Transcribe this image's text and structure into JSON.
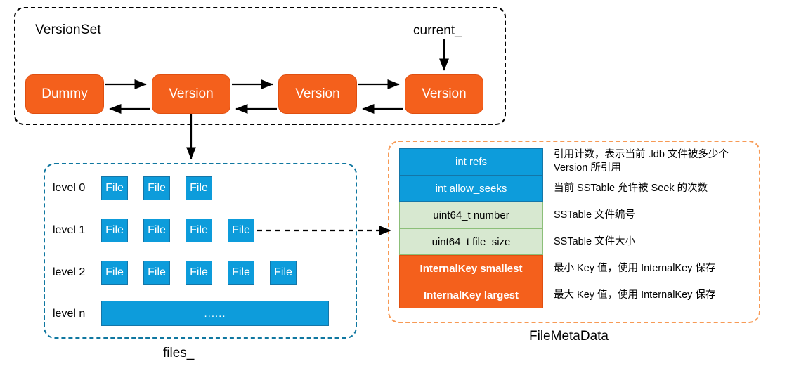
{
  "diagram": {
    "title_hidden": "",
    "colors": {
      "orange_fill": "#F4601C",
      "orange_dashed_border": "#F79A55",
      "blue_fill": "#0D9CDB",
      "blue_dashed_border": "#0F77A0",
      "green_fill": "#D7E8D0",
      "green_border": "#8CBF79",
      "black": "#000000",
      "white": "#FFFFFF"
    }
  },
  "version_set": {
    "label": "VersionSet",
    "current_pointer_label": "current_",
    "nodes": [
      {
        "label": "Dummy"
      },
      {
        "label": "Version"
      },
      {
        "label": "Version"
      },
      {
        "label": "Version"
      }
    ]
  },
  "files": {
    "label": "files_",
    "levels": [
      {
        "name": "level 0",
        "files": [
          "File",
          "File",
          "File"
        ]
      },
      {
        "name": "level 1",
        "files": [
          "File",
          "File",
          "File",
          "File"
        ]
      },
      {
        "name": "level 2",
        "files": [
          "File",
          "File",
          "File",
          "File",
          "File"
        ]
      },
      {
        "name": "level n",
        "bar_label": "......"
      }
    ]
  },
  "file_meta_data": {
    "label": "FileMetaData",
    "rows": [
      {
        "field": "int refs",
        "style": "blue",
        "note": "引用计数，表示当前 .ldb 文件被多少个 Version 所引用"
      },
      {
        "field": "int allow_seeks",
        "style": "blue",
        "note": "当前 SSTable 允许被 Seek 的次数"
      },
      {
        "field": "uint64_t number",
        "style": "green",
        "note": "SSTable 文件编号"
      },
      {
        "field": "uint64_t file_size",
        "style": "green",
        "note": "SSTable 文件大小"
      },
      {
        "field": "InternalKey smallest",
        "style": "orange",
        "note": "最小 Key 值，使用 InternalKey 保存"
      },
      {
        "field": "InternalKey largest",
        "style": "orange",
        "note": "最大 Key 值，使用 InternalKey 保存"
      }
    ]
  }
}
